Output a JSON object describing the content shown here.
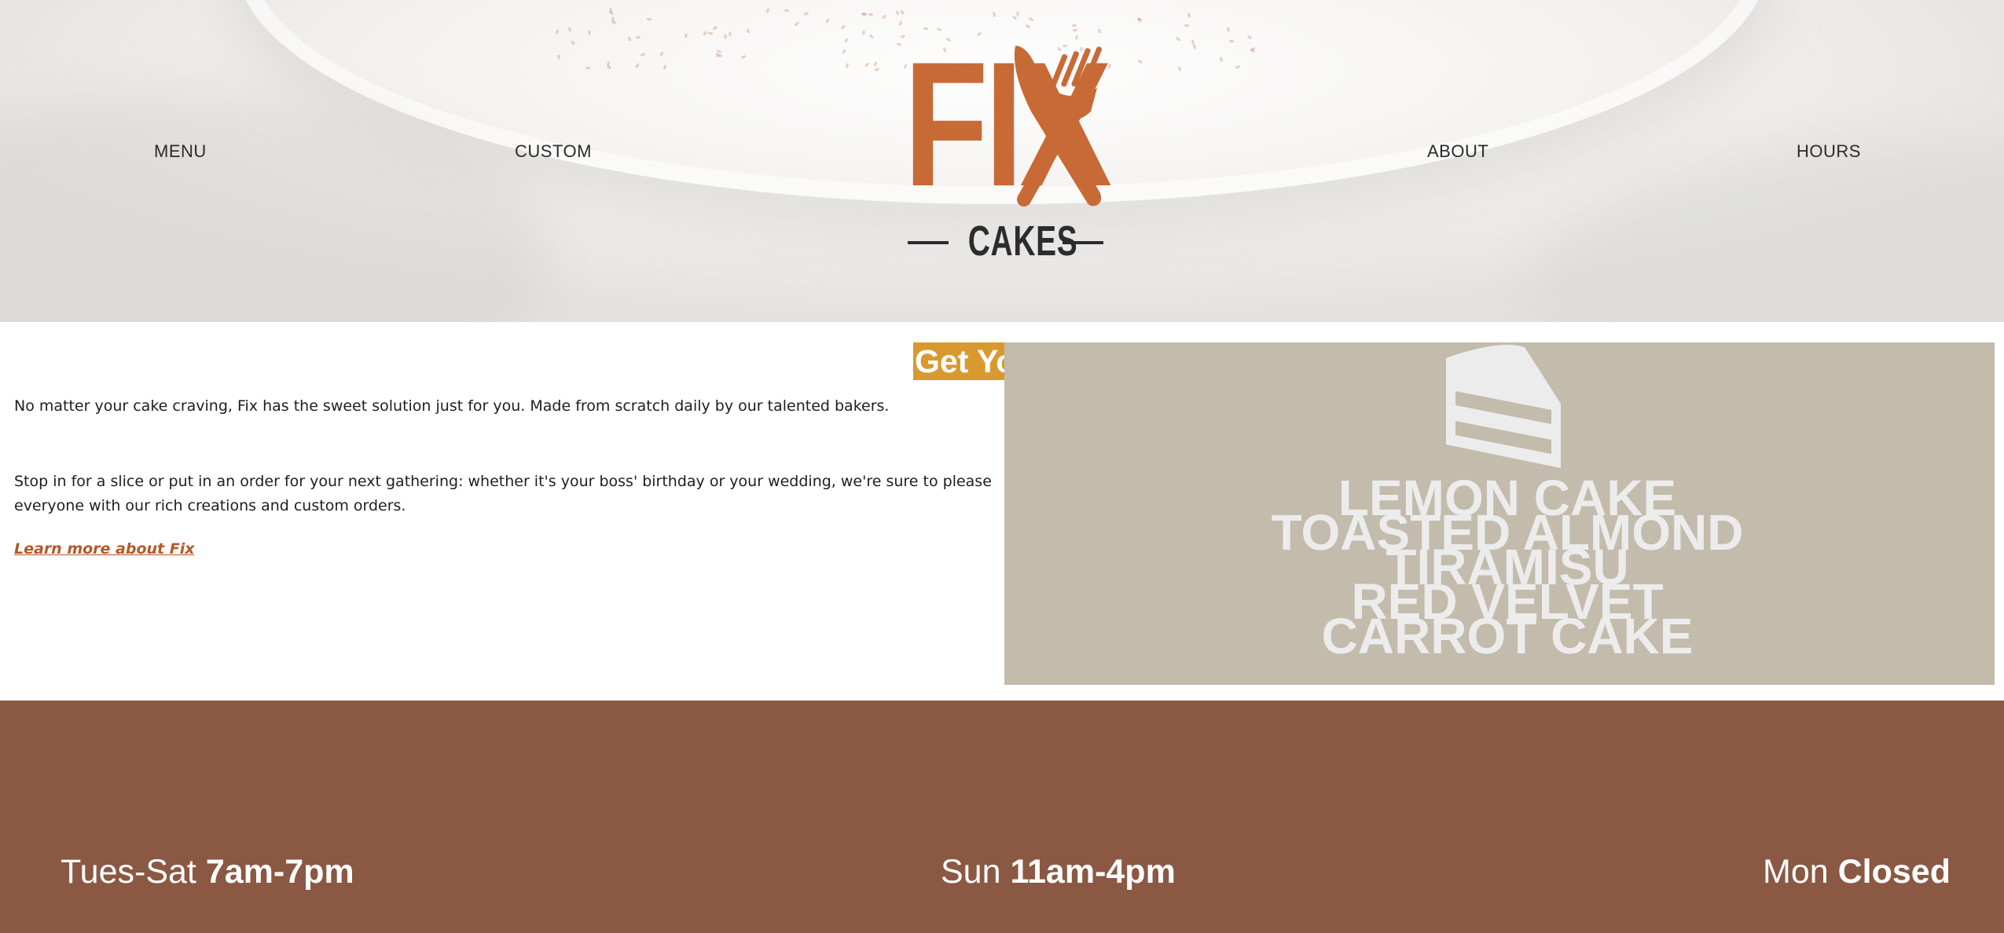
{
  "nav": {
    "left": [
      "MENU",
      "CUSTOM"
    ],
    "right": [
      "ABOUT",
      "HOURS"
    ]
  },
  "logo": {
    "word": "FIX",
    "subtitle": "CAKES",
    "icon": "fork-knife-icon",
    "color": "#c86a35"
  },
  "intro": {
    "heading": "Get Your Fix",
    "paragraphs": [
      "No matter your cake craving, Fix has the sweet solution just for you. Made from scratch daily by our talented bakers.",
      "Stop in for a slice or put in an order for your next gathering: whether it's your boss' birthday or your wedding, we're sure to please everyone with our rich creations and custom orders."
    ],
    "link": "Learn more about Fix"
  },
  "flavors": {
    "icon": "cake-slice-icon",
    "items": [
      "LEMON CAKE",
      "TOASTED ALMOND",
      "TIRAMISU",
      "RED VELVET",
      "CARROT CAKE"
    ]
  },
  "hours": [
    {
      "days": "Tues-Sat",
      "time": "7am-7pm"
    },
    {
      "days": "Sun",
      "time": "11am-4pm"
    },
    {
      "days": "Mon",
      "time": "Closed"
    }
  ],
  "colors": {
    "accent": "#d89a30",
    "link": "#b5582a",
    "flavor_panel": "#c3bbab",
    "hours_bar": "#8b5843"
  }
}
